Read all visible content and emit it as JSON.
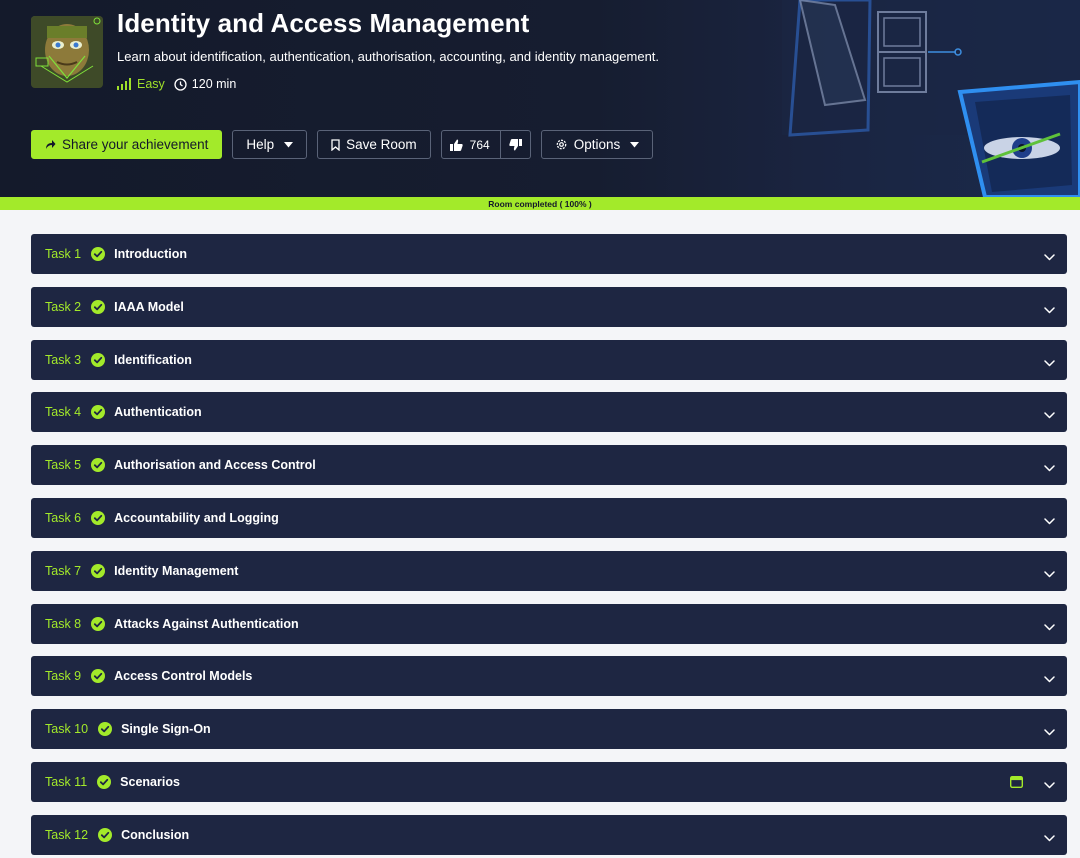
{
  "room": {
    "title": "Identity and Access Management",
    "description": "Learn about identification, authentication, authorisation, accounting, and identity management.",
    "difficulty": "Easy",
    "duration": "120 min"
  },
  "actions": {
    "share_label": "Share your achievement",
    "help_label": "Help",
    "save_label": "Save Room",
    "likes": "764",
    "options_label": "Options"
  },
  "progress": {
    "label": "Room completed ( 100% )",
    "value": 100
  },
  "tasks": [
    {
      "num": "Task 1",
      "title": "Introduction"
    },
    {
      "num": "Task 2",
      "title": "IAAA Model"
    },
    {
      "num": "Task 3",
      "title": "Identification"
    },
    {
      "num": "Task 4",
      "title": "Authentication"
    },
    {
      "num": "Task 5",
      "title": "Authorisation and Access Control"
    },
    {
      "num": "Task 6",
      "title": "Accountability and Logging"
    },
    {
      "num": "Task 7",
      "title": "Identity Management"
    },
    {
      "num": "Task 8",
      "title": "Attacks Against Authentication"
    },
    {
      "num": "Task 9",
      "title": "Access Control Models"
    },
    {
      "num": "Task 10",
      "title": "Single Sign-On"
    },
    {
      "num": "Task 11",
      "title": "Scenarios"
    },
    {
      "num": "Task 12",
      "title": "Conclusion"
    }
  ],
  "colors": {
    "accent": "#a3ea2a",
    "header_bg": "#141a2b",
    "task_bg": "#1e2642",
    "page_bg": "#f4f5f8"
  }
}
